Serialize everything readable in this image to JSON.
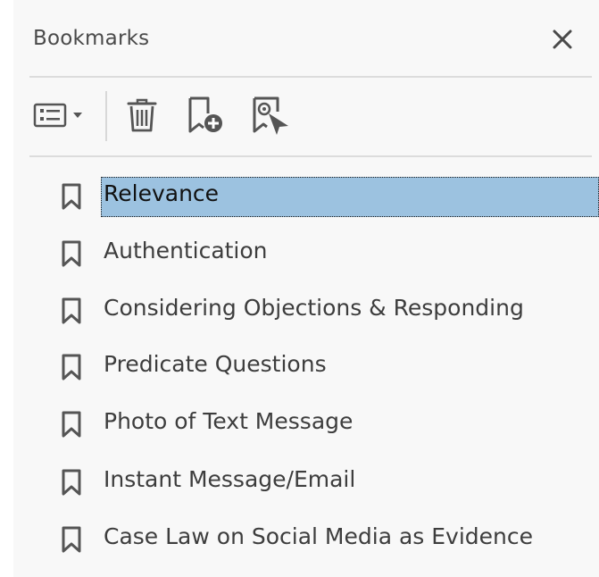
{
  "panel": {
    "title": "Bookmarks",
    "close_icon": "close-icon"
  },
  "toolbar": {
    "options_icon": "options-menu-icon",
    "delete_icon": "trash-icon",
    "new_bookmark_icon": "new-bookmark-icon",
    "find_bookmark_icon": "find-current-bookmark-icon"
  },
  "bookmarks": [
    {
      "label": "Relevance",
      "selected": true
    },
    {
      "label": "Authentication",
      "selected": false
    },
    {
      "label": "Considering Objections & Responding",
      "selected": false
    },
    {
      "label": "Predicate Questions",
      "selected": false
    },
    {
      "label": "Photo of Text Message",
      "selected": false
    },
    {
      "label": "Instant Message/Email",
      "selected": false
    },
    {
      "label": "Case Law on Social Media as Evidence",
      "selected": false
    }
  ],
  "colors": {
    "selection": "#9cc2e0",
    "panel_bg": "#f8f8f8",
    "icon": "#555555"
  }
}
